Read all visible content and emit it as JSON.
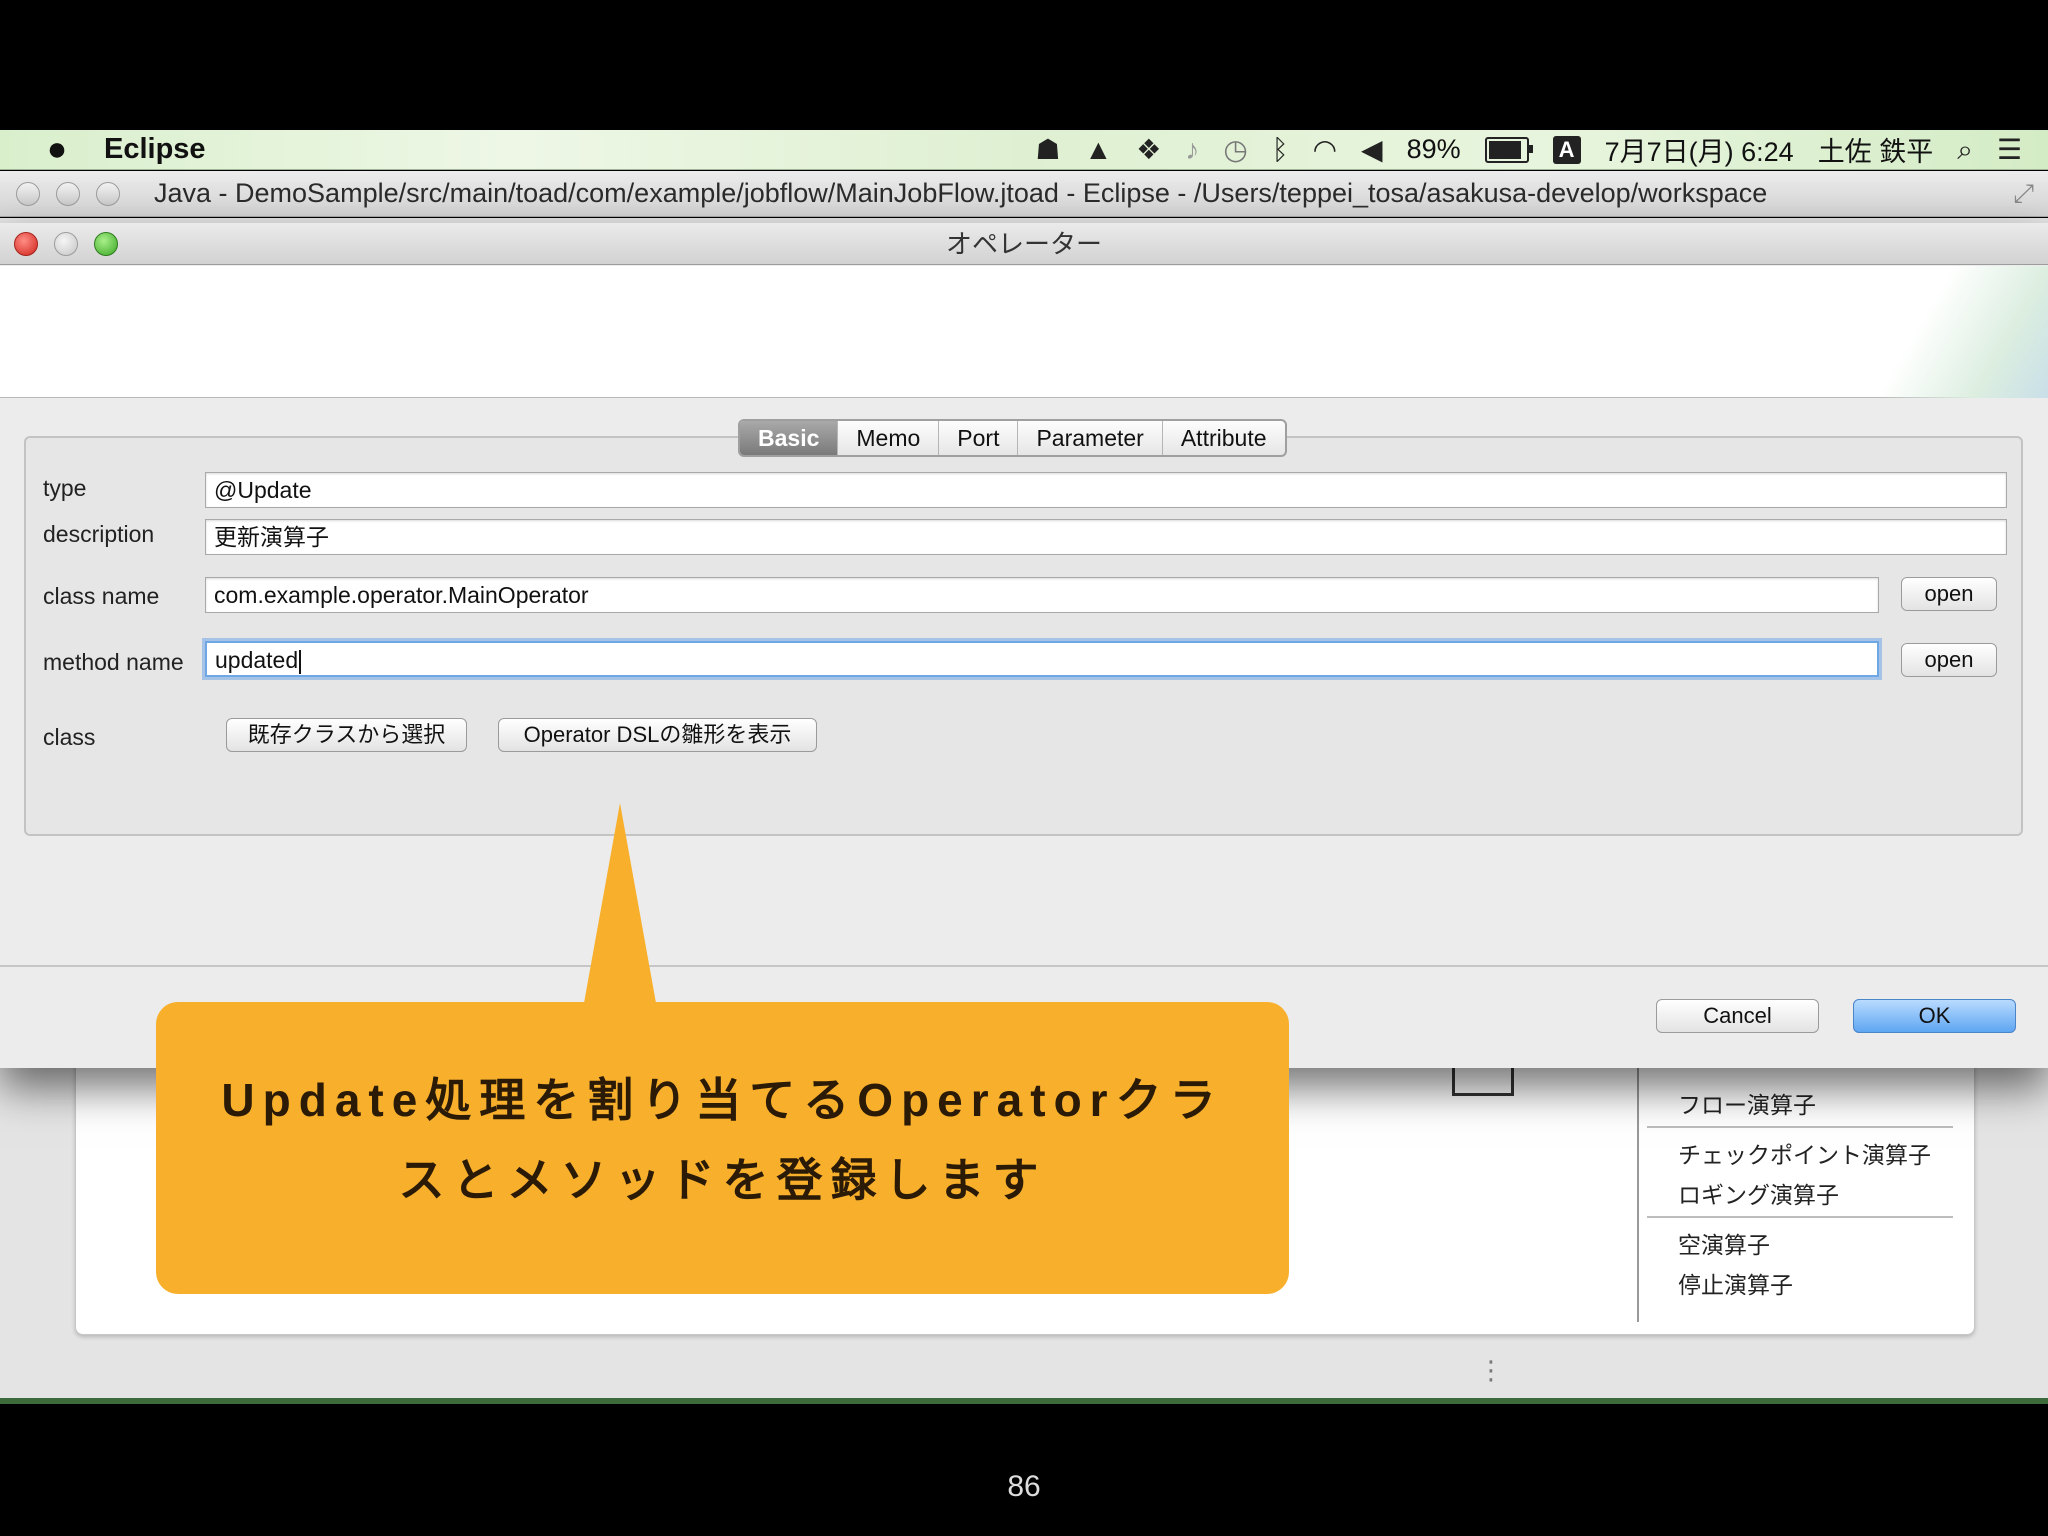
{
  "menubar": {
    "app_name": "Eclipse",
    "battery_percent": "89%",
    "battery_level": 0.89,
    "input_indicator": "A",
    "date_time": "7月7日(月) 6:24",
    "user_name": "土佐 鉄平",
    "status_icons": [
      "evernote-icon",
      "google-drive-icon",
      "dropbox-icon",
      "notification-bell-icon",
      "time-machine-icon",
      "bluetooth-icon",
      "wifi-icon",
      "volume-icon"
    ]
  },
  "eclipse_window": {
    "title": "Java - DemoSample/src/main/toad/com/example/jobflow/MainJobFlow.jtoad - Eclipse - /Users/teppei_tosa/asakusa-develop/workspace"
  },
  "palette": {
    "items": [
      "フロー演算子",
      "チェックポイント演算子",
      "ロギング演算子",
      "空演算子",
      "停止演算子"
    ]
  },
  "dialog": {
    "title": "オペレーター",
    "tabs": [
      "Basic",
      "Memo",
      "Port",
      "Parameter",
      "Attribute"
    ],
    "active_tab": "Basic",
    "fields": {
      "type": {
        "label": "type",
        "value": "@Update"
      },
      "description": {
        "label": "description",
        "value": "更新演算子"
      },
      "class_name": {
        "label": "class name",
        "value": "com.example.operator.MainOperator",
        "button": "open"
      },
      "method_name": {
        "label": "method name",
        "value": "updated",
        "button": "open"
      },
      "class": {
        "label": "class",
        "button_existing": "既存クラスから選択",
        "button_dsl": "Operator DSLの雛形を表示"
      }
    },
    "cancel_label": "Cancel",
    "ok_label": "OK"
  },
  "callout": {
    "line1": "Update処理を割り当てるOperatorクラ",
    "line2": "スとメソッドを登録します",
    "color": "#f8b02c"
  },
  "slide": {
    "page_number": "86"
  }
}
